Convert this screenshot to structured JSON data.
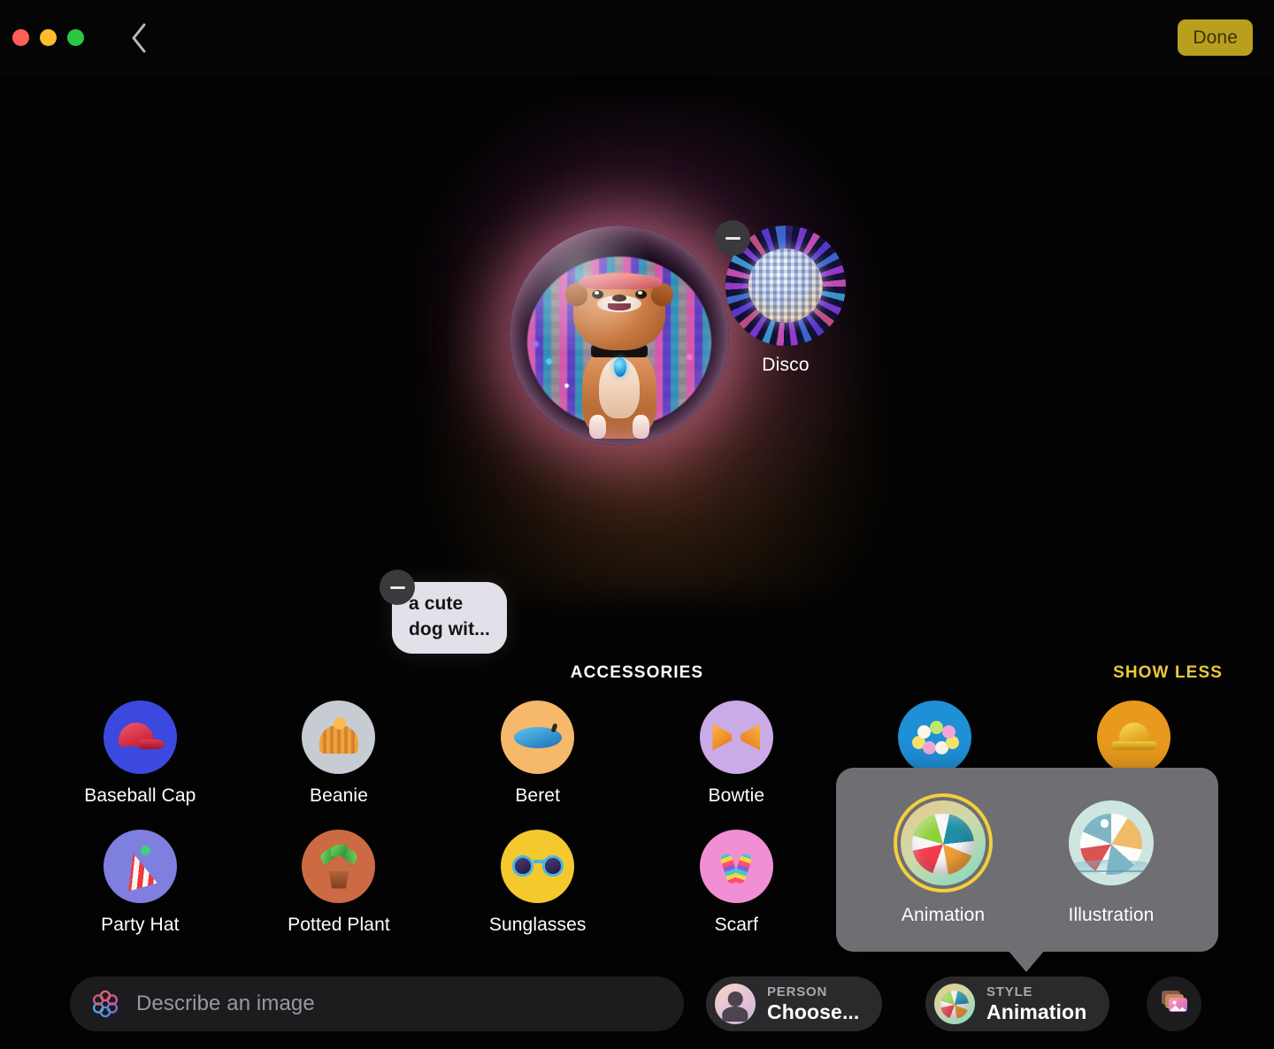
{
  "titlebar": {
    "back_icon": "chevron-left-icon",
    "done_label": "Done",
    "traffic": {
      "close": "close-window-button",
      "minimize": "minimize-window-button",
      "zoom": "zoom-window-button"
    }
  },
  "canvas": {
    "generated_image_alt": "cute dog in front of a disco ball inside a bubble",
    "concept_chip": {
      "label": "Disco",
      "remove_label": "remove-disco-concept"
    },
    "prompt_chip": {
      "text": "a cute\ndog wit...",
      "remove_label": "remove-prompt-concept"
    }
  },
  "accessories": {
    "title": "ACCESSORIES",
    "show_less": "SHOW LESS",
    "items": [
      {
        "label": "Baseball Cap",
        "bg": "#3b49df",
        "glyph": "baseball-cap"
      },
      {
        "label": "Beanie",
        "bg": "#c6ccd2",
        "glyph": "beanie"
      },
      {
        "label": "Beret",
        "bg": "#f6b86a",
        "glyph": "beret"
      },
      {
        "label": "Bowtie",
        "bg": "#cbaae8",
        "glyph": "bowtie"
      },
      {
        "label": "Flower Crown",
        "bg": "#1f8fd6",
        "glyph": "flower-crown"
      },
      {
        "label": "Hard Hat",
        "bg": "#e89a1c",
        "glyph": "hard-hat"
      },
      {
        "label": "Party Hat",
        "bg": "#7f7fe0",
        "glyph": "party-hat"
      },
      {
        "label": "Potted Plant",
        "bg": "#cc6a43",
        "glyph": "potted-plant"
      },
      {
        "label": "Sunglasses",
        "bg": "#f3c92e",
        "glyph": "sunglasses"
      },
      {
        "label": "Scarf",
        "bg": "#f08fd4",
        "glyph": "scarf"
      }
    ]
  },
  "style_popover": {
    "options": [
      {
        "label": "Animation",
        "selected": true
      },
      {
        "label": "Illustration",
        "selected": false
      }
    ],
    "selection_color": "#f2d03a",
    "background": "#6e6e73"
  },
  "bottombar": {
    "describe_placeholder": "Describe an image",
    "person": {
      "kicker": "PERSON",
      "value": "Choose..."
    },
    "style": {
      "kicker": "STYLE",
      "value": "Animation"
    },
    "photo_picker_icon": "photo-library-icon"
  }
}
